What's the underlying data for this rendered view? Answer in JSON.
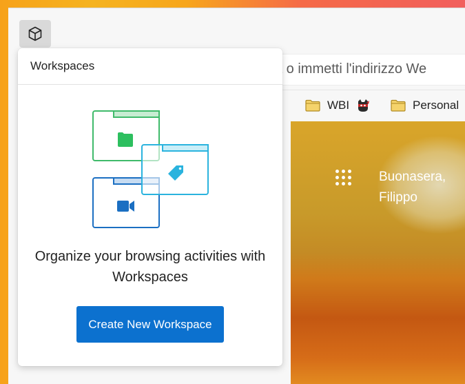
{
  "panel": {
    "title": "Workspaces",
    "headline": "Organize your browsing activities with Workspaces",
    "cta_label": "Create New Workspace"
  },
  "address_bar": {
    "text": "a o immetti l'indirizzo We"
  },
  "favorites": [
    {
      "label": "WBI",
      "icon": "folder-icon"
    },
    {
      "label": "Personal",
      "icon": "folder-icon"
    }
  ],
  "new_tab": {
    "greeting": "Buonasera, Filippo"
  },
  "colors": {
    "accent": "#0c71cf",
    "folder": "#f5d36b"
  }
}
